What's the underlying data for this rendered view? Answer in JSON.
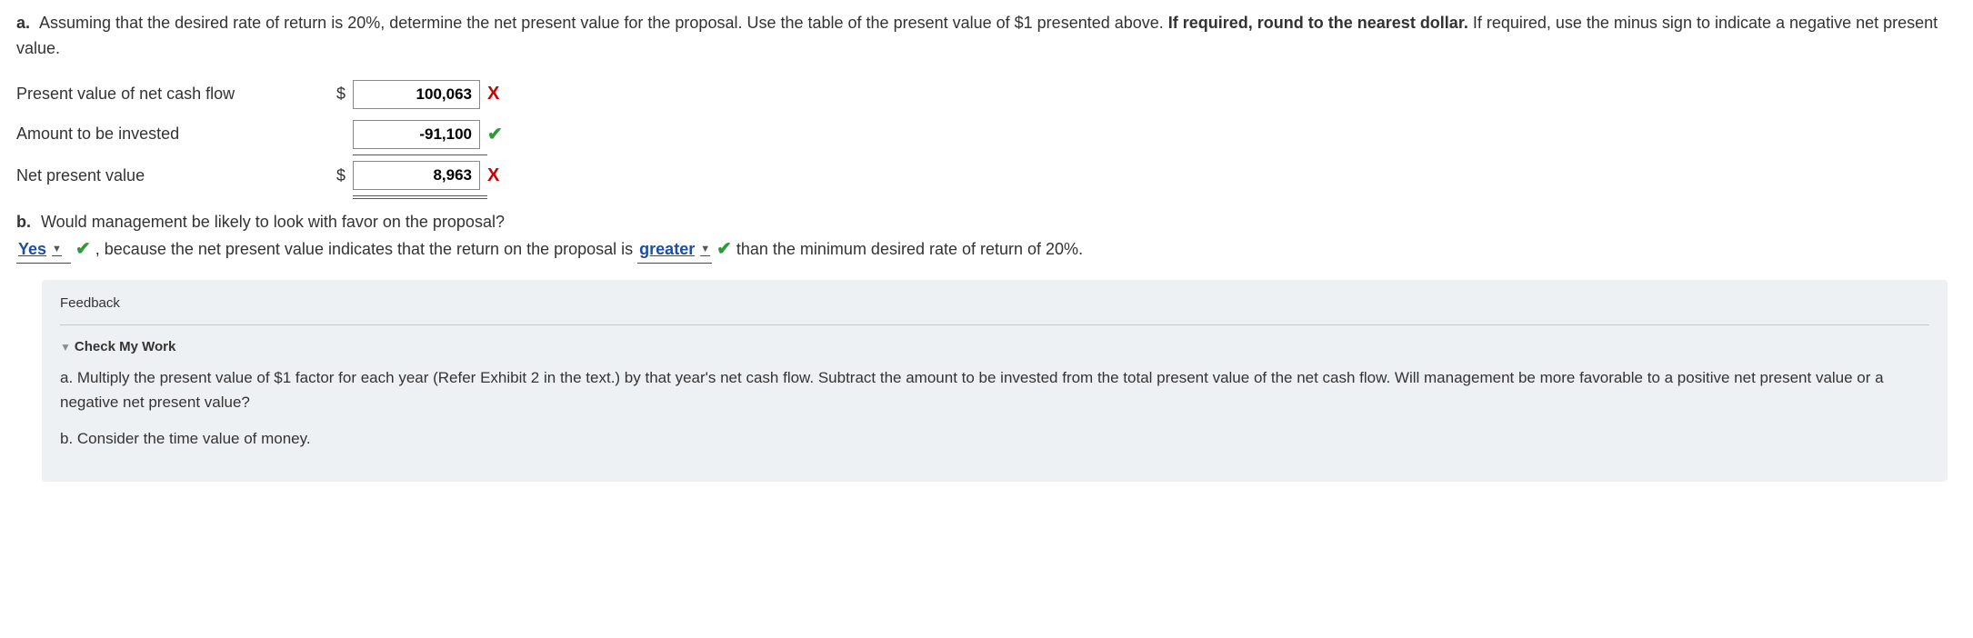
{
  "partA": {
    "label": "a.",
    "text_before_bold": " Assuming that the desired rate of return is 20%, determine the net present value for the proposal. Use the table of the present value of $1 presented above. ",
    "bold_text": "If required, round to the nearest dollar.",
    "text_after_bold": " If required, use the minus sign to indicate a negative net present value."
  },
  "rows": {
    "pv": {
      "label": "Present value of net cash flow",
      "prefix": "$",
      "value": "100,063",
      "mark": "x"
    },
    "inv": {
      "label": "Amount to be invested",
      "prefix": "",
      "value": "-91,100",
      "mark": "v"
    },
    "npv": {
      "label": "Net present value",
      "prefix": "$",
      "value": "8,963",
      "mark": "x"
    }
  },
  "partB": {
    "label": "b.",
    "question": " Would management be likely to look with favor on the proposal?",
    "select1": "Yes",
    "mark1": "v",
    "mid_text": " , because the net present value indicates that the return on the proposal is ",
    "select2": "greater",
    "mark2": "v",
    "tail_text": " than the minimum desired rate of return of 20%."
  },
  "feedback": {
    "title": "Feedback",
    "check_my_work": "Check My Work",
    "body_a": "a. Multiply the present value of $1 factor for each year (Refer Exhibit 2 in the text.) by that year's net cash flow. Subtract the amount to be invested from the total present value of the net cash flow. Will management be more favorable to a positive net present value or a negative net present value?",
    "body_b": "b. Consider the time value of money."
  },
  "glyphs": {
    "x": "X",
    "v": "✔",
    "caret": "▼",
    "tri": "▼"
  }
}
